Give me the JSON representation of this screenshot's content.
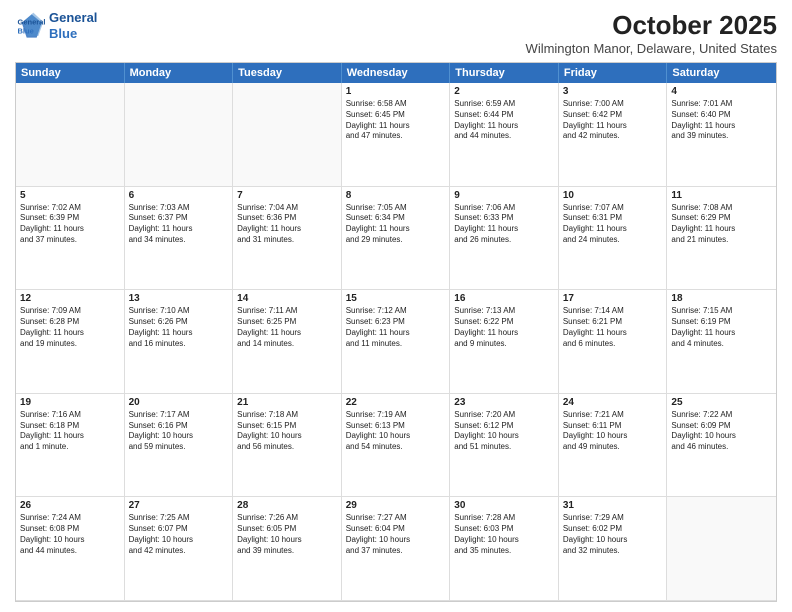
{
  "header": {
    "logo_line1": "General",
    "logo_line2": "Blue",
    "month": "October 2025",
    "location": "Wilmington Manor, Delaware, United States"
  },
  "days_of_week": [
    "Sunday",
    "Monday",
    "Tuesday",
    "Wednesday",
    "Thursday",
    "Friday",
    "Saturday"
  ],
  "weeks": [
    [
      {
        "num": "",
        "text": "",
        "empty": true
      },
      {
        "num": "",
        "text": "",
        "empty": true
      },
      {
        "num": "",
        "text": "",
        "empty": true
      },
      {
        "num": "1",
        "text": "Sunrise: 6:58 AM\nSunset: 6:45 PM\nDaylight: 11 hours\nand 47 minutes.",
        "empty": false
      },
      {
        "num": "2",
        "text": "Sunrise: 6:59 AM\nSunset: 6:44 PM\nDaylight: 11 hours\nand 44 minutes.",
        "empty": false
      },
      {
        "num": "3",
        "text": "Sunrise: 7:00 AM\nSunset: 6:42 PM\nDaylight: 11 hours\nand 42 minutes.",
        "empty": false
      },
      {
        "num": "4",
        "text": "Sunrise: 7:01 AM\nSunset: 6:40 PM\nDaylight: 11 hours\nand 39 minutes.",
        "empty": false
      }
    ],
    [
      {
        "num": "5",
        "text": "Sunrise: 7:02 AM\nSunset: 6:39 PM\nDaylight: 11 hours\nand 37 minutes.",
        "empty": false
      },
      {
        "num": "6",
        "text": "Sunrise: 7:03 AM\nSunset: 6:37 PM\nDaylight: 11 hours\nand 34 minutes.",
        "empty": false
      },
      {
        "num": "7",
        "text": "Sunrise: 7:04 AM\nSunset: 6:36 PM\nDaylight: 11 hours\nand 31 minutes.",
        "empty": false
      },
      {
        "num": "8",
        "text": "Sunrise: 7:05 AM\nSunset: 6:34 PM\nDaylight: 11 hours\nand 29 minutes.",
        "empty": false
      },
      {
        "num": "9",
        "text": "Sunrise: 7:06 AM\nSunset: 6:33 PM\nDaylight: 11 hours\nand 26 minutes.",
        "empty": false
      },
      {
        "num": "10",
        "text": "Sunrise: 7:07 AM\nSunset: 6:31 PM\nDaylight: 11 hours\nand 24 minutes.",
        "empty": false
      },
      {
        "num": "11",
        "text": "Sunrise: 7:08 AM\nSunset: 6:29 PM\nDaylight: 11 hours\nand 21 minutes.",
        "empty": false
      }
    ],
    [
      {
        "num": "12",
        "text": "Sunrise: 7:09 AM\nSunset: 6:28 PM\nDaylight: 11 hours\nand 19 minutes.",
        "empty": false
      },
      {
        "num": "13",
        "text": "Sunrise: 7:10 AM\nSunset: 6:26 PM\nDaylight: 11 hours\nand 16 minutes.",
        "empty": false
      },
      {
        "num": "14",
        "text": "Sunrise: 7:11 AM\nSunset: 6:25 PM\nDaylight: 11 hours\nand 14 minutes.",
        "empty": false
      },
      {
        "num": "15",
        "text": "Sunrise: 7:12 AM\nSunset: 6:23 PM\nDaylight: 11 hours\nand 11 minutes.",
        "empty": false
      },
      {
        "num": "16",
        "text": "Sunrise: 7:13 AM\nSunset: 6:22 PM\nDaylight: 11 hours\nand 9 minutes.",
        "empty": false
      },
      {
        "num": "17",
        "text": "Sunrise: 7:14 AM\nSunset: 6:21 PM\nDaylight: 11 hours\nand 6 minutes.",
        "empty": false
      },
      {
        "num": "18",
        "text": "Sunrise: 7:15 AM\nSunset: 6:19 PM\nDaylight: 11 hours\nand 4 minutes.",
        "empty": false
      }
    ],
    [
      {
        "num": "19",
        "text": "Sunrise: 7:16 AM\nSunset: 6:18 PM\nDaylight: 11 hours\nand 1 minute.",
        "empty": false
      },
      {
        "num": "20",
        "text": "Sunrise: 7:17 AM\nSunset: 6:16 PM\nDaylight: 10 hours\nand 59 minutes.",
        "empty": false
      },
      {
        "num": "21",
        "text": "Sunrise: 7:18 AM\nSunset: 6:15 PM\nDaylight: 10 hours\nand 56 minutes.",
        "empty": false
      },
      {
        "num": "22",
        "text": "Sunrise: 7:19 AM\nSunset: 6:13 PM\nDaylight: 10 hours\nand 54 minutes.",
        "empty": false
      },
      {
        "num": "23",
        "text": "Sunrise: 7:20 AM\nSunset: 6:12 PM\nDaylight: 10 hours\nand 51 minutes.",
        "empty": false
      },
      {
        "num": "24",
        "text": "Sunrise: 7:21 AM\nSunset: 6:11 PM\nDaylight: 10 hours\nand 49 minutes.",
        "empty": false
      },
      {
        "num": "25",
        "text": "Sunrise: 7:22 AM\nSunset: 6:09 PM\nDaylight: 10 hours\nand 46 minutes.",
        "empty": false
      }
    ],
    [
      {
        "num": "26",
        "text": "Sunrise: 7:24 AM\nSunset: 6:08 PM\nDaylight: 10 hours\nand 44 minutes.",
        "empty": false
      },
      {
        "num": "27",
        "text": "Sunrise: 7:25 AM\nSunset: 6:07 PM\nDaylight: 10 hours\nand 42 minutes.",
        "empty": false
      },
      {
        "num": "28",
        "text": "Sunrise: 7:26 AM\nSunset: 6:05 PM\nDaylight: 10 hours\nand 39 minutes.",
        "empty": false
      },
      {
        "num": "29",
        "text": "Sunrise: 7:27 AM\nSunset: 6:04 PM\nDaylight: 10 hours\nand 37 minutes.",
        "empty": false
      },
      {
        "num": "30",
        "text": "Sunrise: 7:28 AM\nSunset: 6:03 PM\nDaylight: 10 hours\nand 35 minutes.",
        "empty": false
      },
      {
        "num": "31",
        "text": "Sunrise: 7:29 AM\nSunset: 6:02 PM\nDaylight: 10 hours\nand 32 minutes.",
        "empty": false
      },
      {
        "num": "",
        "text": "",
        "empty": true
      }
    ]
  ]
}
